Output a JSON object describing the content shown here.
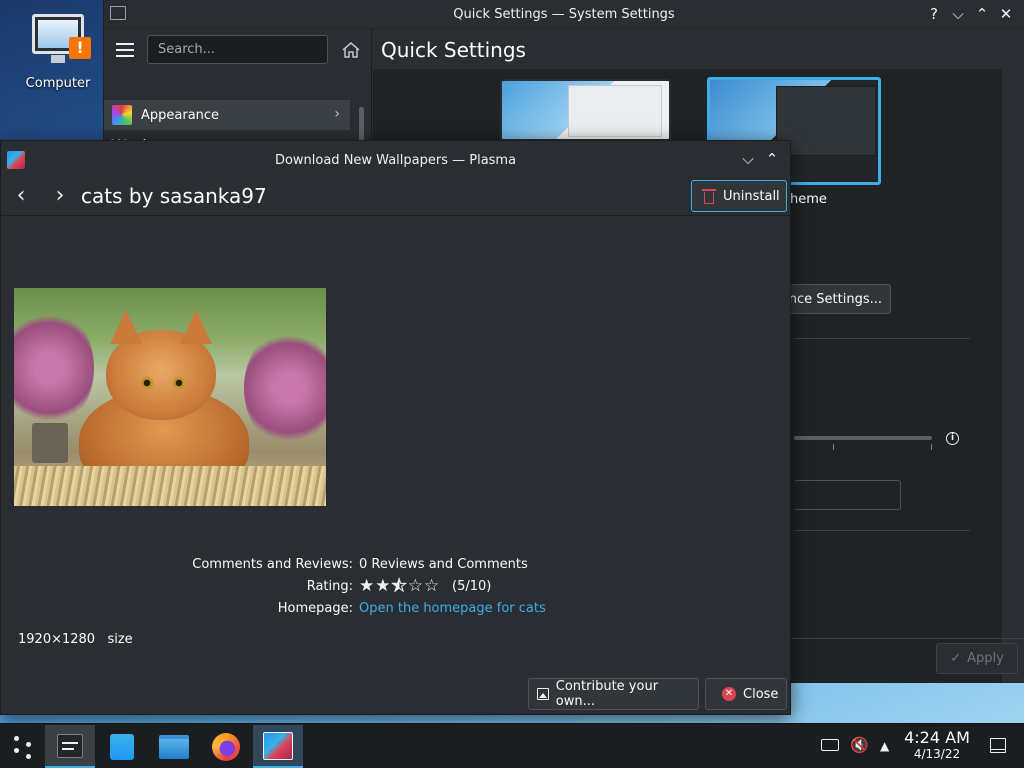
{
  "desktop": {
    "icon_label": "Computer"
  },
  "system_settings": {
    "window_title": "Quick Settings — System Settings",
    "search_placeholder": "Search...",
    "sidebar_item": "Appearance",
    "sidebar_section": "Workspace",
    "page_title": "Quick Settings",
    "theme_label": "heme",
    "more_settings_label": "ance Settings...",
    "apply_label": "Apply"
  },
  "dialog": {
    "window_title": "Download New Wallpapers — Plasma",
    "item_title": "cats by sasanka97",
    "uninstall_label": "Uninstall",
    "comments_key": "Comments and Reviews:",
    "comments_value": "0 Reviews and Comments",
    "rating_key": "Rating:",
    "rating_value": "(5/10)",
    "rating_stars": 2.5,
    "homepage_key": "Homepage:",
    "homepage_link": "Open the homepage for cats",
    "resolution": "1920×1280",
    "size_label": "size",
    "contribute_label": "Contribute your own...",
    "close_label": "Close"
  },
  "taskbar": {
    "time": "4:24 AM",
    "date": "4/13/22"
  },
  "colors": {
    "accent": "#3daee9",
    "negative": "#da4453",
    "link": "#3daee9"
  }
}
